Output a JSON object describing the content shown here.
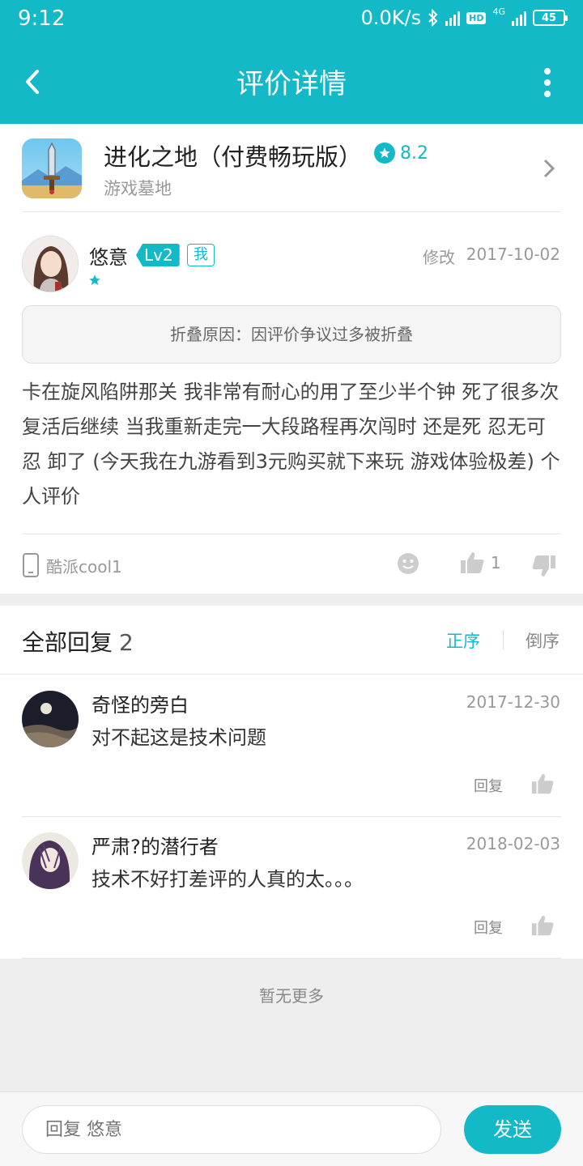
{
  "status_bar": {
    "time": "9:12",
    "net_speed": "0.0K/s",
    "hd": "HD",
    "net_type": "4G",
    "battery": "45"
  },
  "header": {
    "title": "评价详情",
    "back_icon": "back-arrow-icon",
    "more_icon": "more-vertical-icon"
  },
  "game": {
    "name": "进化之地（付费畅玩版）",
    "rating": "8.2",
    "category": "游戏墓地"
  },
  "review": {
    "username": "悠意",
    "level": "Lv2",
    "me_badge": "我",
    "edit_label": "修改",
    "date": "2017-10-02",
    "fold_reason": "折叠原因：因评价争议过多被折叠",
    "content": "卡在旋风陷阱那关 我非常有耐心的用了至少半个钟 死了很多次 复活后继续 当我重新走完一大段路程再次闯时 还是死 忍无可忍 卸了 (今天我在九游看到3元购买就下来玩 游戏体验极差) 个人评价",
    "device": "酷派cool1",
    "like_count": "1"
  },
  "replies_section": {
    "title": "全部回复",
    "count": "2",
    "order_asc": "正序",
    "order_desc": "倒序",
    "items": [
      {
        "name": "奇怪的旁白",
        "date": "2017-12-30",
        "text": "对不起这是技术问题",
        "reply_label": "回复"
      },
      {
        "name": "严肃?的潜行者",
        "date": "2018-02-03",
        "text": "技术不好打差评的人真的太。。。",
        "reply_label": "回复"
      }
    ]
  },
  "footer": {
    "no_more": "暂无更多",
    "input_placeholder": "回复 悠意",
    "send_label": "发送"
  },
  "colors": {
    "accent": "#14b9c8"
  }
}
